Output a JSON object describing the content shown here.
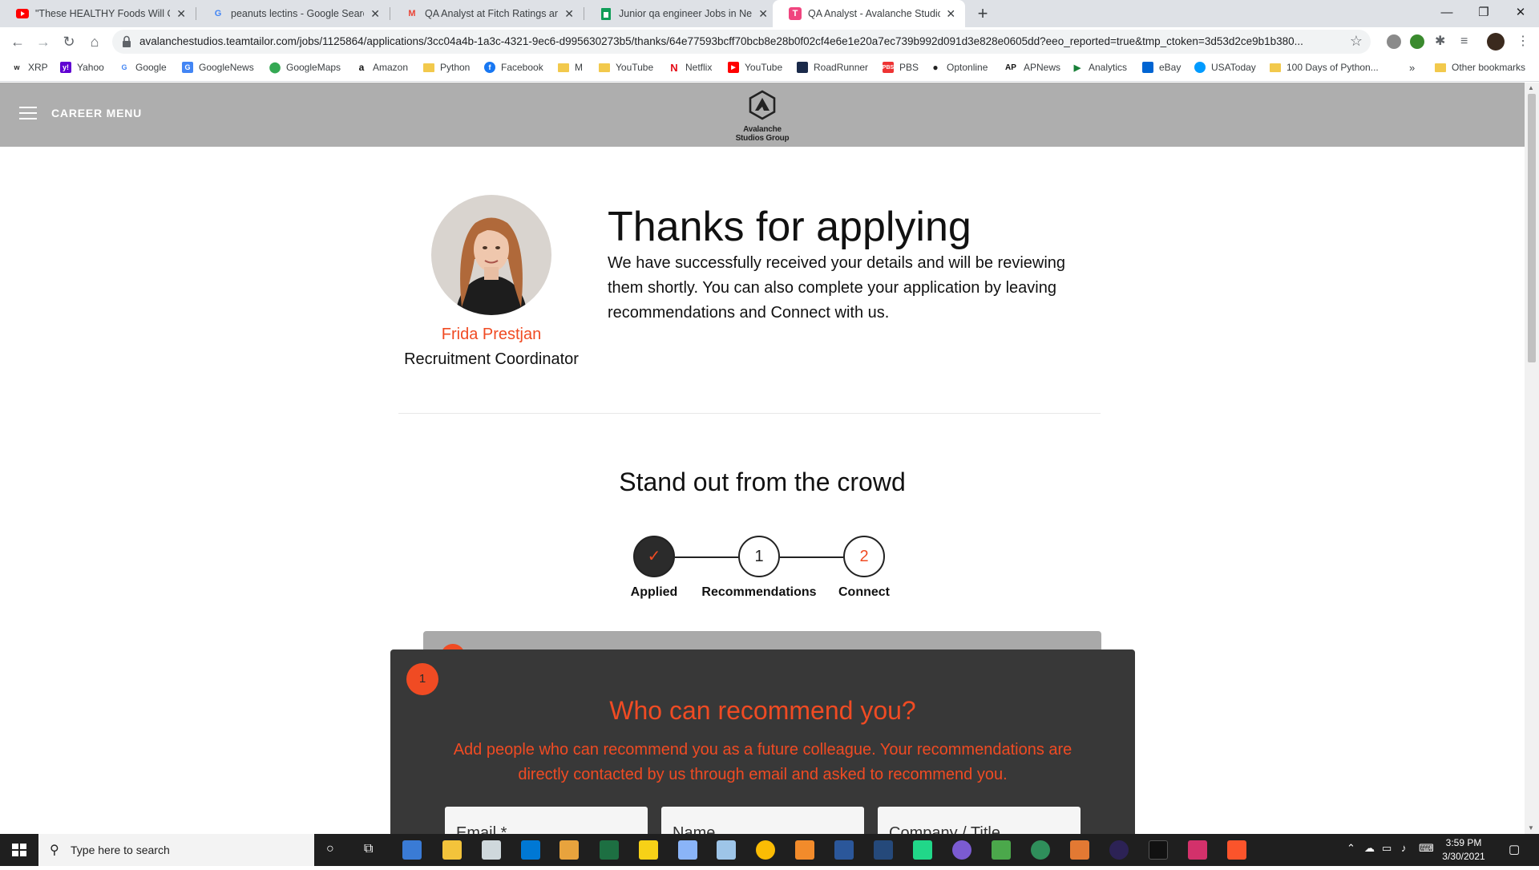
{
  "browser": {
    "tabs": [
      {
        "title": "\"These HEALTHY Foods Will COM",
        "icon": "youtube-icon",
        "color": "#ff0000"
      },
      {
        "title": "peanuts lectins - Google Search",
        "icon": "google-icon",
        "color": "#4285f4"
      },
      {
        "title": "QA Analyst at Fitch Ratings and S",
        "icon": "gmail-icon",
        "color": "#ea4335"
      },
      {
        "title": "Junior qa engineer Jobs in New Y",
        "icon": "sheets-icon",
        "color": "#0f9d58"
      },
      {
        "title": "QA Analyst - Avalanche Studios",
        "icon": "teamtailor-icon",
        "color": "#f0457f"
      }
    ],
    "url": "avalanchestudios.teamtailor.com/jobs/1125864/applications/3cc04a4b-1a3c-4321-9ec6-d995630273b5/thanks/64e77593bcff70bcb8e28b0f02cf4e6e1e20a7ec739b992d091d3e828e0605dd?eeo_reported=true&tmp_ctoken=3d53d2ce9b1b380...",
    "bookmarks": [
      {
        "label": "XRP"
      },
      {
        "label": "Yahoo"
      },
      {
        "label": "Google"
      },
      {
        "label": "GoogleNews"
      },
      {
        "label": "GoogleMaps"
      },
      {
        "label": "Amazon"
      },
      {
        "label": "Python"
      },
      {
        "label": "Facebook"
      },
      {
        "label": "M"
      },
      {
        "label": "YouTube"
      },
      {
        "label": "Netflix"
      },
      {
        "label": "YouTube"
      },
      {
        "label": "RoadRunner"
      },
      {
        "label": "PBS"
      },
      {
        "label": "Optonline"
      },
      {
        "label": "APNews"
      },
      {
        "label": "Analytics"
      },
      {
        "label": "eBay"
      },
      {
        "label": "USAToday"
      },
      {
        "label": "100 Days of Python..."
      }
    ],
    "overflow": "»",
    "other_bookmarks": "Other bookmarks"
  },
  "site": {
    "menu_label": "CAREER MENU",
    "logo_line1": "Avalanche",
    "logo_line2": "Studios Group",
    "accent": "#f04b23"
  },
  "recruiter": {
    "name": "Frida Prestjan",
    "title": "Recruitment Coordinator"
  },
  "thanks": {
    "title": "Thanks for applying",
    "body": "We have successfully received your details and will be reviewing them shortly. You can also complete your application by leaving recommendations and Connect with us."
  },
  "standout": {
    "title": "Stand out from the crowd",
    "steps": [
      {
        "label": "Applied",
        "mark": "✓"
      },
      {
        "label": "Recommendations",
        "mark": "1"
      },
      {
        "label": "Connect",
        "mark": "2"
      }
    ]
  },
  "recommend": {
    "badge": "1",
    "title": "Who can recommend you?",
    "description": "Add people who can recommend you as a future colleague. Your recommendations are directly contacted by us through email and asked to recommend you.",
    "email_placeholder": "Email *",
    "name_placeholder": "Name",
    "company_placeholder": "Company / Title"
  },
  "taskbar": {
    "search_placeholder": "Type here to search",
    "time": "3:59 PM",
    "date": "3/30/2021"
  }
}
